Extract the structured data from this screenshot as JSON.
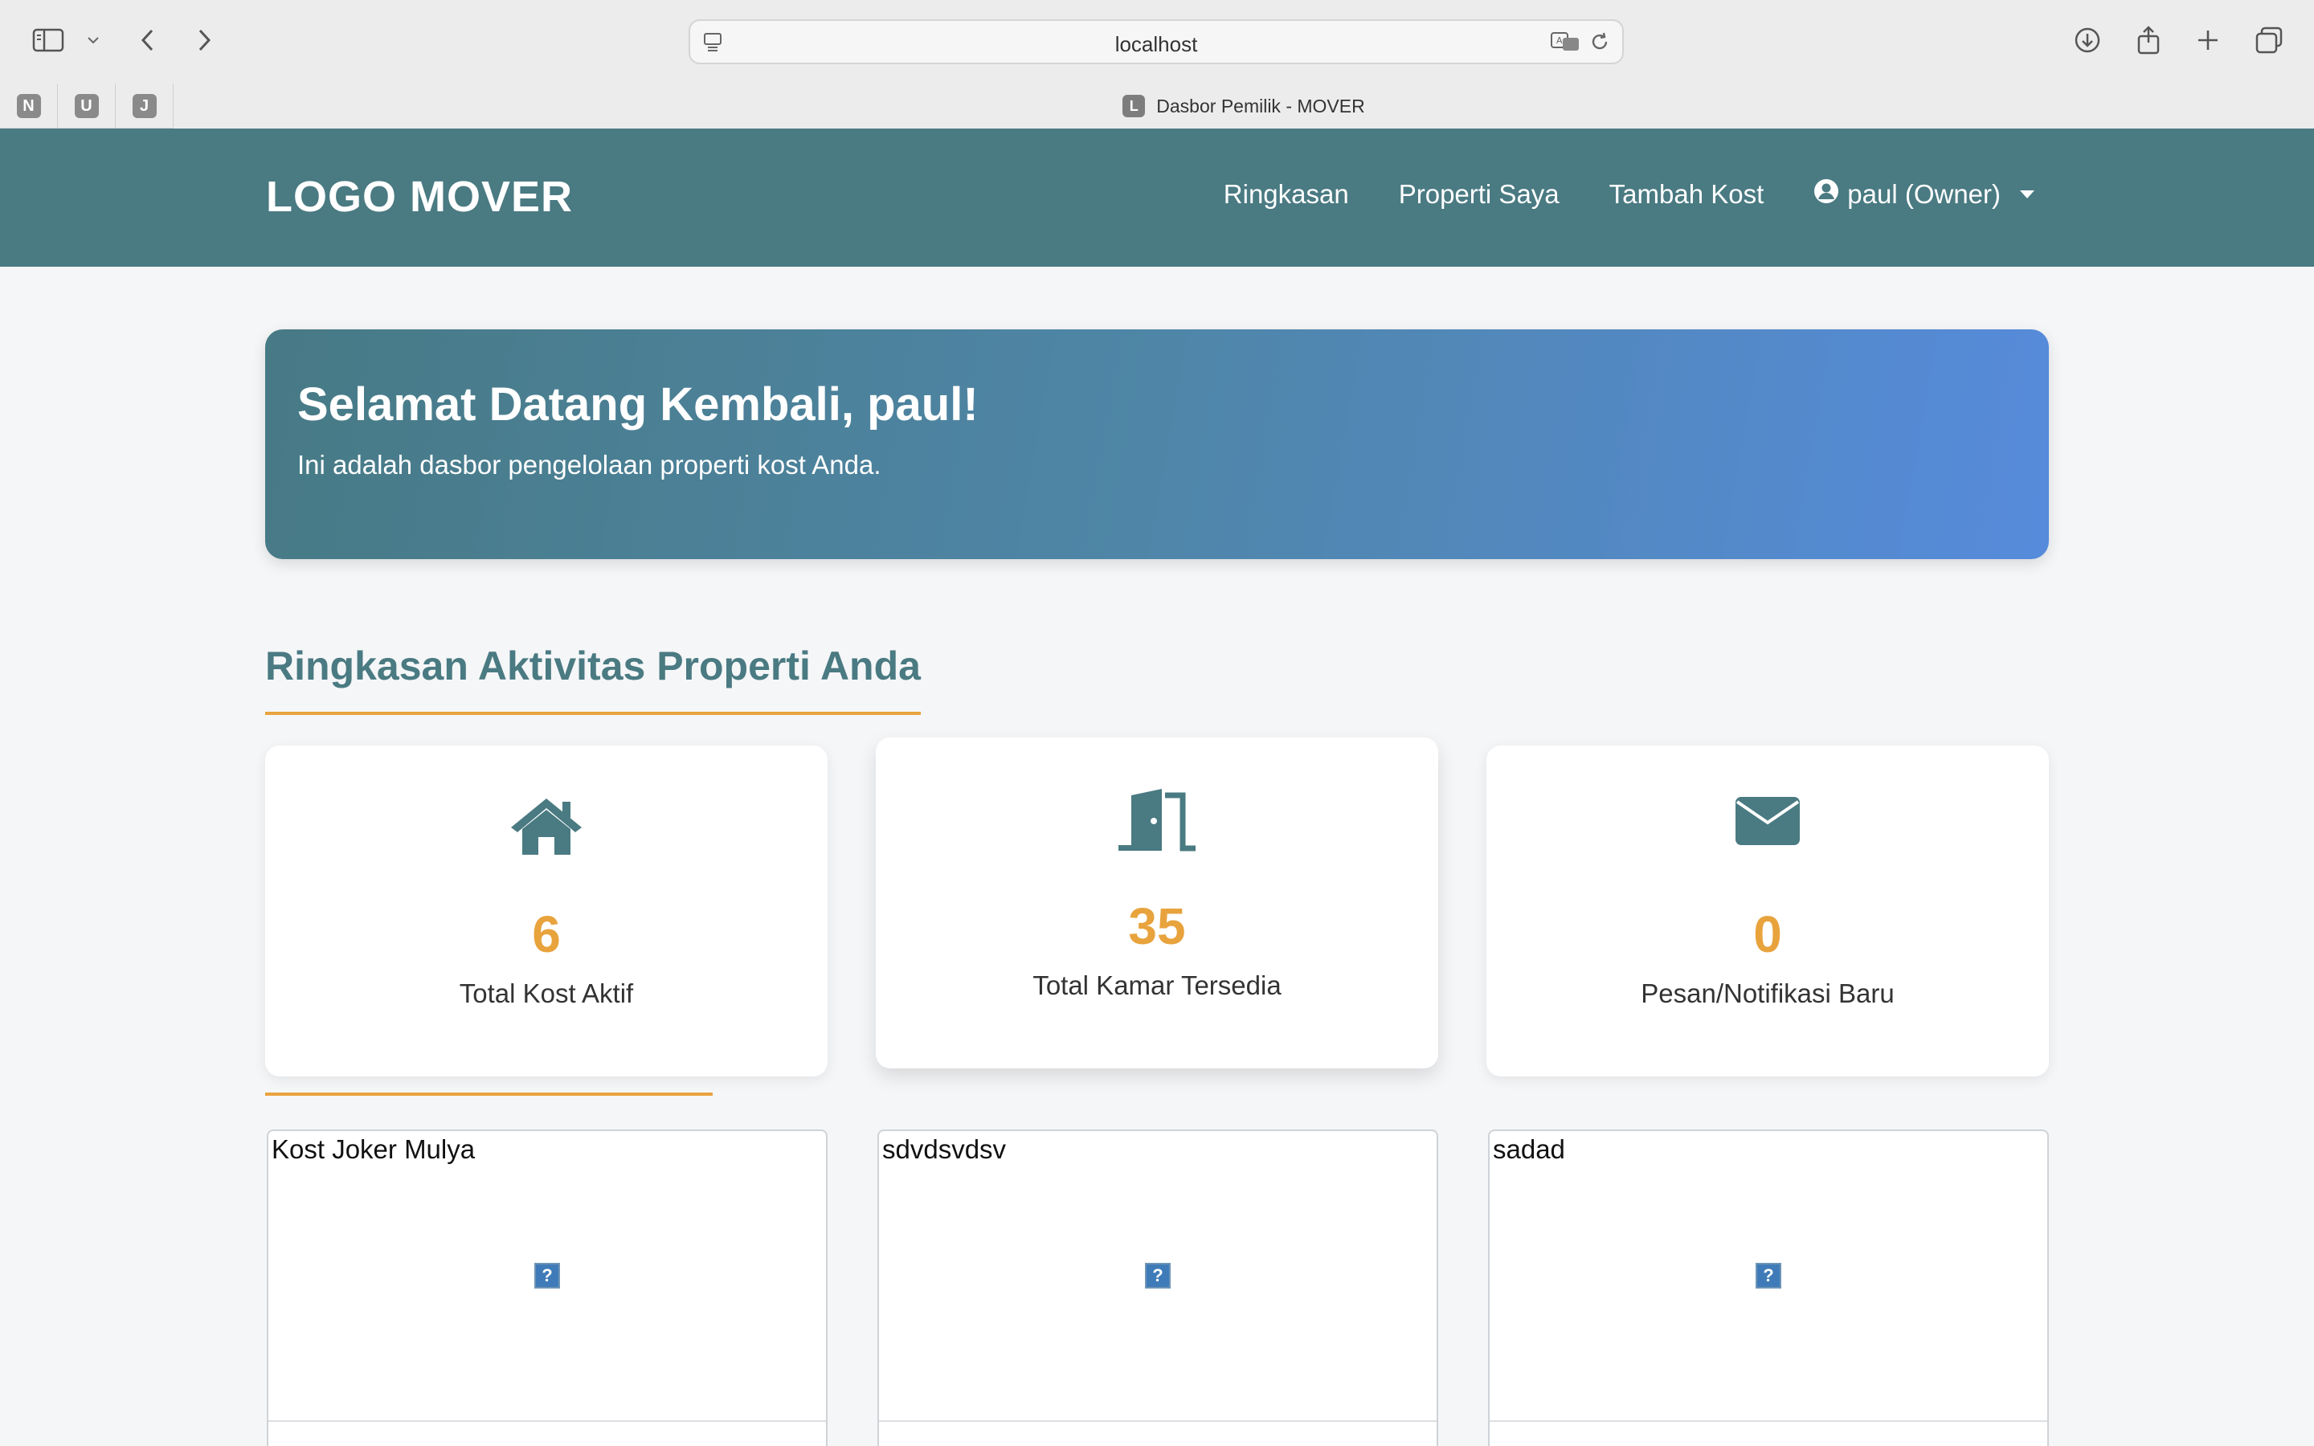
{
  "browser": {
    "url": "localhost",
    "tab_title": "Dasbor Pemilik - MOVER",
    "tab_favicon_letter": "L",
    "pinned_tabs": [
      "N",
      "U",
      "J"
    ]
  },
  "navbar": {
    "logo": "LOGO MOVER",
    "links": [
      "Ringkasan",
      "Properti Saya",
      "Tambah Kost"
    ],
    "user_label": "paul (Owner)",
    "bg_color": "#4a7a82"
  },
  "hero": {
    "title": "Selamat Datang Kembali, paul!",
    "subtitle": "Ini adalah dasbor pengelolaan properti kost Anda."
  },
  "summary": {
    "title": "Ringkasan Aktivitas Properti Anda",
    "stats": [
      {
        "icon": "home-icon",
        "value": "6",
        "label": "Total Kost Aktif"
      },
      {
        "icon": "door-icon",
        "value": "35",
        "label": "Total Kamar Tersedia"
      },
      {
        "icon": "envelope-icon",
        "value": "0",
        "label": "Pesan/Notifikasi Baru"
      }
    ],
    "accent_color": "#e8a33d"
  },
  "properties": [
    {
      "name": "Kost Joker Mulya",
      "image_placeholder": "?"
    },
    {
      "name": "sdvdsvdsv",
      "image_placeholder": "?"
    },
    {
      "name": "sadad",
      "image_placeholder": "?"
    }
  ]
}
